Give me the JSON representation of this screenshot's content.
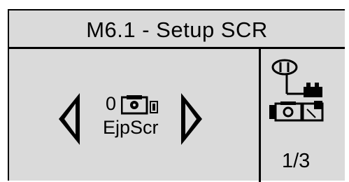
{
  "header": {
    "title": "M6.1 - Setup SCR"
  },
  "main": {
    "selected_index": "0",
    "selected_label": "EjpScr",
    "selected_icon": "scr-device-icon",
    "nav_left_icon": "arrow-left-icon",
    "nav_right_icon": "arrow-right-icon"
  },
  "side": {
    "icon": "system-topology-icon",
    "page_indicator": "1/3"
  },
  "colors": {
    "background": "#dadada",
    "foreground": "#000000"
  }
}
